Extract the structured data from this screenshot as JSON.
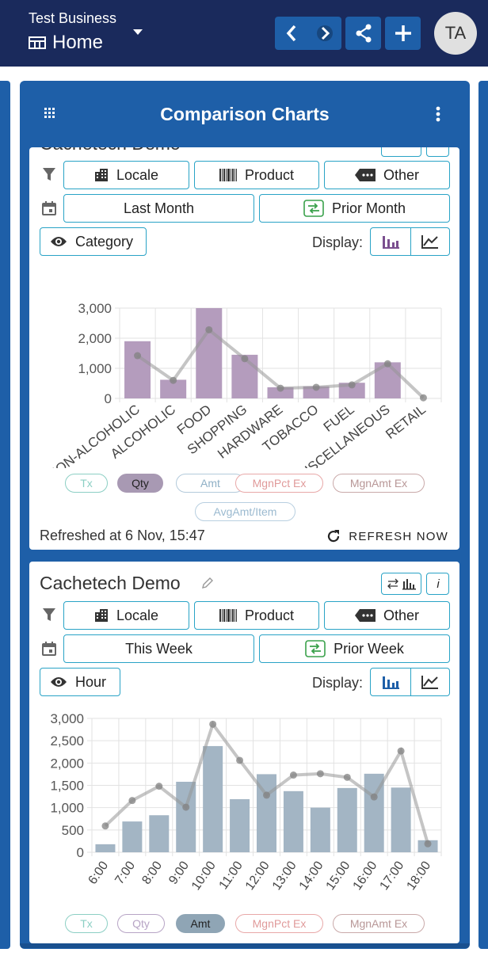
{
  "header": {
    "business": "Test Business",
    "page": "Home",
    "avatar_initials": "TA"
  },
  "panel": {
    "title": "Comparison Charts"
  },
  "card1": {
    "title": "Cachetech Demo",
    "filters": {
      "locale": "Locale",
      "product": "Product",
      "other": "Other"
    },
    "period": "Last Month",
    "compare": "Prior Month",
    "group_by": "Category",
    "display_label": "Display:",
    "chips": [
      "Tx",
      "Qty",
      "Amt",
      "MgnPct Ex",
      "MgnAmt Ex",
      "AvgAmt/Item"
    ],
    "active_chip": "Qty",
    "refreshed": "Refreshed at 6 Nov, 15:47",
    "refresh_now": "REFRESH NOW"
  },
  "card2": {
    "title": "Cachetech Demo",
    "filters": {
      "locale": "Locale",
      "product": "Product",
      "other": "Other"
    },
    "period": "This Week",
    "compare": "Prior Week",
    "group_by": "Hour",
    "display_label": "Display:",
    "chips": [
      "Tx",
      "Qty",
      "Amt",
      "MgnPct Ex",
      "MgnAmt Ex"
    ],
    "active_chip": "Amt"
  },
  "colors": {
    "topbar": "#1a2a5c",
    "accent": "#1e5fa8",
    "outline": "#29a3c6",
    "bar_qty": "#b49cbd",
    "bar_amt": "#a3b5c4"
  },
  "chart_data": [
    {
      "type": "bar",
      "categories": [
        "NON-ALCOHOLIC",
        "ALCOHOLIC",
        "FOOD",
        "SHOPPING",
        "HARDWARE",
        "TOBACCO",
        "FUEL",
        "MISCELLANEOUS",
        "RETAIL"
      ],
      "series": [
        {
          "values": [
            1900,
            620,
            3000,
            1450,
            370,
            400,
            520,
            1200,
            0
          ]
        },
        {
          "values": [
            1420,
            600,
            2280,
            1320,
            340,
            370,
            450,
            1150,
            20
          ]
        }
      ],
      "ylim": [
        0,
        3000
      ],
      "yticks": [
        "3,000",
        "2,000",
        "1,000",
        "0"
      ]
    },
    {
      "type": "bar",
      "categories": [
        "6:00",
        "7:00",
        "8:00",
        "9:00",
        "10:00",
        "11:00",
        "12:00",
        "13:00",
        "14:00",
        "15:00",
        "16:00",
        "17:00",
        "18:00"
      ],
      "series": [
        {
          "values": [
            180,
            690,
            830,
            1580,
            2380,
            1190,
            1750,
            1370,
            1000,
            1440,
            1760,
            1450,
            270
          ]
        },
        {
          "values": [
            590,
            1160,
            1480,
            1010,
            2870,
            2060,
            1280,
            1730,
            1760,
            1680,
            1240,
            2270,
            190
          ]
        }
      ],
      "ylim": [
        0,
        3000
      ],
      "yticks": [
        "3,000",
        "2,500",
        "2,000",
        "1,500",
        "1,000",
        "500",
        "0"
      ]
    }
  ]
}
